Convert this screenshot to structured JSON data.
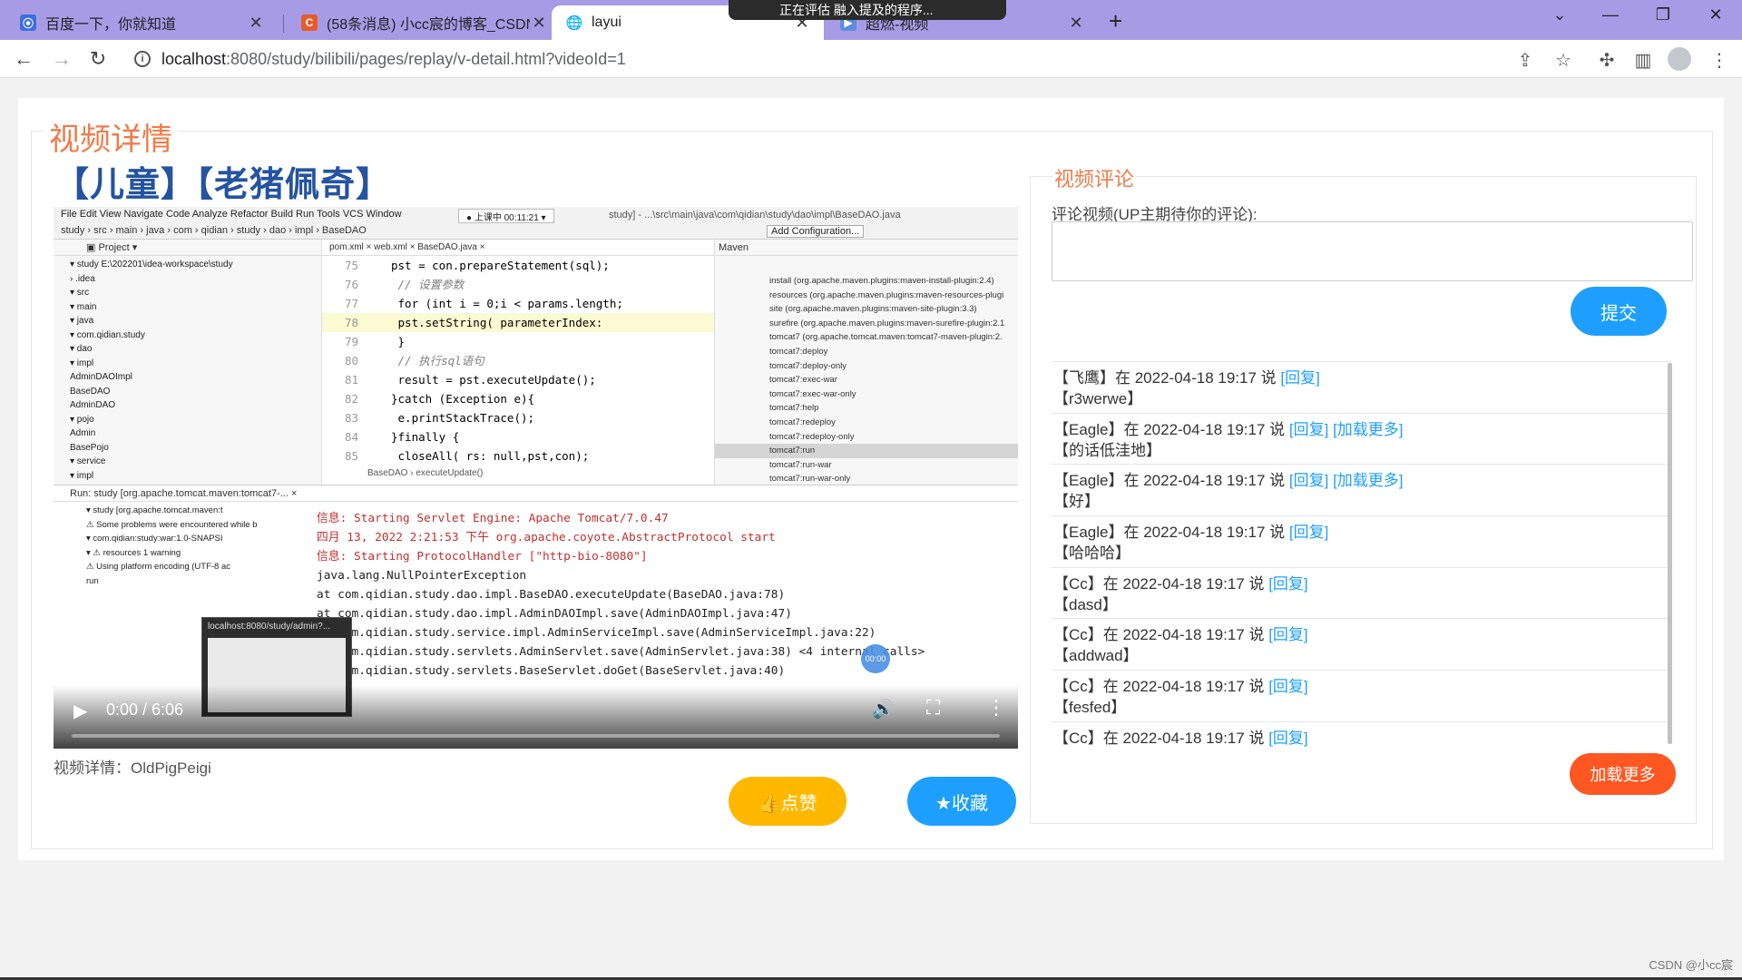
{
  "browser": {
    "tabs": [
      {
        "title": "百度一下，你就知道",
        "favicon_color": "#3b6fe0",
        "favicon_glyph": "⦿",
        "active": false
      },
      {
        "title": "(58条消息) 小cc宸的博客_CSDN",
        "favicon_color": "#e65b2b",
        "favicon_glyph": "C",
        "active": false
      },
      {
        "title": "layui",
        "favicon_color": "#777777",
        "favicon_glyph": "🌐",
        "active": true
      },
      {
        "title": "超燃-视频",
        "favicon_color": "#5a8de0",
        "favicon_glyph": "▶",
        "active": false
      }
    ],
    "overlay_text": "正在评估 融入提及的程序...",
    "url_host": "localhost",
    "url_path": ":8080/study/bilibili/pages/replay/v-detail.html?videoId=1"
  },
  "page": {
    "legend": "视频详情",
    "video_title": "【儿童】【老猪佩奇】",
    "video_desc": "视频详情：OldPigPeigi",
    "like_label": "👍点赞",
    "fav_label": "★收藏"
  },
  "player": {
    "time": "0:00 / 6:06",
    "progress_fraction": 0.0,
    "scrub_label": "00:00",
    "thumb_title": "localhost:8080/study/admin?...",
    "ide": {
      "menu": "File  Edit  View  Navigate  Code  Analyze  Refactor  Build  Run  Tools  VCS  Window",
      "rec": "● 上课中 00:11:21 ▾",
      "path": "study] - ...\\src\\main\\java\\com\\qidian\\study\\dao\\impl\\BaseDAO.java",
      "crumbs": "study › src › main › java › com › qidian › study › dao › impl › BaseDAO",
      "add_cfg": "Add Configuration...",
      "project_hdr": "▣ Project ▾",
      "tree": [
        "▾ study  E:\\202201\\idea-workspace\\study",
        "   › .idea",
        "   ▾ src",
        "      ▾ main",
        "         ▾ java",
        "            ▾ com.qidian.study",
        "               ▾ dao",
        "                  ▾ impl",
        "                        AdminDAOImpl",
        "                        BaseDAO",
        "                     AdminDAO",
        "               ▾ pojo",
        "                     Admin",
        "                     BasePojo",
        "               ▾ service",
        "                  ▾ impl"
      ],
      "editor_tabs": "pom.xml ×    web.xml ×    BaseDAO.java ×",
      "code": [
        {
          "n": "75",
          "t": "pst = con.prepareStatement(sql);",
          "cls": ""
        },
        {
          "n": "76",
          "t": "    // 设置参数",
          "cls": "cm"
        },
        {
          "n": "77",
          "t": "    for (int i = 0;i < params.length;",
          "cls": ""
        },
        {
          "n": "78",
          "t": "        pst.setString( parameterIndex:",
          "cls": "hl"
        },
        {
          "n": "79",
          "t": "    }",
          "cls": ""
        },
        {
          "n": "80",
          "t": "    // 执行sql语句",
          "cls": "cm"
        },
        {
          "n": "81",
          "t": "    result = pst.executeUpdate();",
          "cls": ""
        },
        {
          "n": "82",
          "t": "}catch (Exception e){",
          "cls": ""
        },
        {
          "n": "83",
          "t": "    e.printStackTrace();",
          "cls": ""
        },
        {
          "n": "84",
          "t": "}finally {",
          "cls": ""
        },
        {
          "n": "85",
          "t": "    closeAll( rs: null,pst,con);",
          "cls": ""
        }
      ],
      "editor_crumbs": "BaseDAO  ›  executeUpdate()",
      "maven_hdr": "Maven",
      "maven": [
        "install (org.apache.maven.plugins:maven-install-plugin:2.4)",
        "resources (org.apache.maven.plugins:maven-resources-plugi",
        "site (org.apache.maven.plugins:maven-site-plugin:3.3)",
        "surefire (org.apache.maven.plugins:maven-surefire-plugin:2.1",
        "tomcat7 (org.apache.tomcat.maven:tomcat7-maven-plugin:2.",
        "   tomcat7:deploy",
        "   tomcat7:deploy-only",
        "   tomcat7:exec-war",
        "   tomcat7:exec-war-only",
        "   tomcat7:help",
        "   tomcat7:redeploy",
        "   tomcat7:redeploy-only",
        "   tomcat7:run",
        "   tomcat7:run-war",
        "   tomcat7:run-war-only"
      ],
      "run_hdr": "Run:   study [org.apache.tomcat.maven:tomcat7-...  ×",
      "run_tree": [
        "▾ study [org.apache.tomcat.maven:t",
        "   ⚠ Some problems were encountered while b",
        " ▾ com.qidian:study:war:1.0-SNAPSI",
        "    ▾ ⚠ resources  1 warning",
        "          ⚠ Using platform encoding (UTF-8 ac",
        "       run"
      ],
      "console": [
        {
          "t": "信息: Starting Servlet Engine: Apache Tomcat/7.0.47",
          "cls": "red"
        },
        {
          "t": "四月 13, 2022 2:21:53 下午 org.apache.coyote.AbstractProtocol start",
          "cls": "red"
        },
        {
          "t": "信息: Starting ProtocolHandler [\"http-bio-8080\"]",
          "cls": "red"
        },
        {
          "t": "java.lang.NullPointerException",
          "cls": ""
        },
        {
          "t": "    at com.qidian.study.dao.impl.BaseDAO.executeUpdate(BaseDAO.java:78)",
          "cls": ""
        },
        {
          "t": "    at com.qidian.study.dao.impl.AdminDAOImpl.save(AdminDAOImpl.java:47)",
          "cls": ""
        },
        {
          "t": "    at com.qidian.study.service.impl.AdminServiceImpl.save(AdminServiceImpl.java:22)",
          "cls": ""
        },
        {
          "t": "    at com.qidian.study.servlets.AdminServlet.save(AdminServlet.java:38) <4 internal calls>",
          "cls": ""
        },
        {
          "t": "    at com.qidian.study.servlets.BaseServlet.doGet(BaseServlet.java:40)",
          "cls": ""
        }
      ]
    }
  },
  "comments": {
    "legend": "视频评论",
    "label": "评论视频(UP主期待你的评论):",
    "textarea_value": "",
    "submit_label": "提交",
    "reply_label": "[回复]",
    "more_label": "[加载更多]",
    "load_more_button": "加载更多",
    "items": [
      {
        "user": "【飞鹰】",
        "meta": "在 2022-04-18 19:17 说",
        "text": "【r3werwe】",
        "has_more": false
      },
      {
        "user": "【Eagle】",
        "meta": "在 2022-04-18 19:17 说",
        "text": "【的话低洼地】",
        "has_more": true
      },
      {
        "user": "【Eagle】",
        "meta": "在 2022-04-18 19:17 说",
        "text": "【好】",
        "has_more": true
      },
      {
        "user": "【Eagle】",
        "meta": "在 2022-04-18 19:17 说",
        "text": "【哈哈哈】",
        "has_more": false
      },
      {
        "user": "【Cc】",
        "meta": "在 2022-04-18 19:17 说",
        "text": "【dasd】",
        "has_more": false
      },
      {
        "user": "【Cc】",
        "meta": "在 2022-04-18 19:17 说",
        "text": "【addwad】",
        "has_more": false
      },
      {
        "user": "【Cc】",
        "meta": "在 2022-04-18 19:17 说",
        "text": "【fesfed】",
        "has_more": false
      },
      {
        "user": "【Cc】",
        "meta": "在 2022-04-18 19:17 说",
        "text": "【…】",
        "has_more": false
      }
    ]
  },
  "watermark": "CSDN @小cc宸",
  "colors": {
    "accent_orange": "#f07b4a",
    "title_blue": "#2453a0",
    "like_yellow": "#ffb800",
    "layui_blue": "#1e9fff",
    "load_more_red": "#ff5722",
    "tab_bar": "#a89be6"
  }
}
